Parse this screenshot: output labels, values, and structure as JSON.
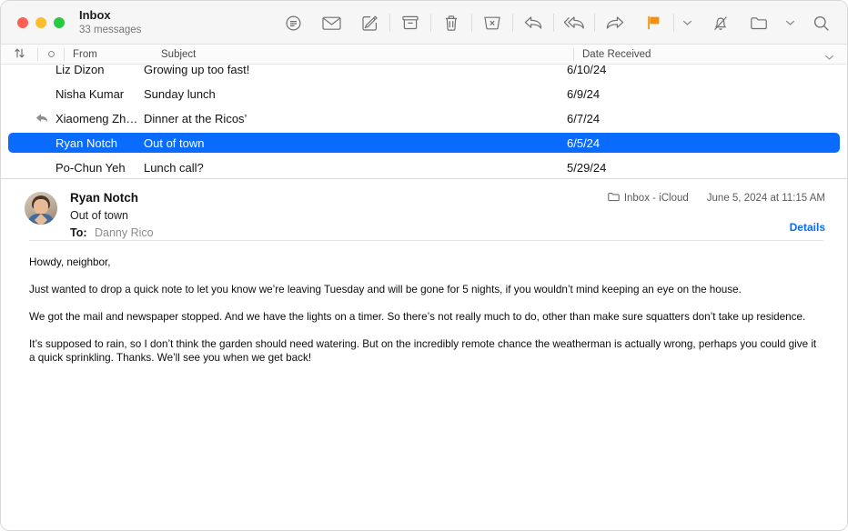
{
  "window": {
    "title": "Inbox",
    "subtitle": "33 messages",
    "traffic_lights": [
      "close-red",
      "minimize-yellow",
      "zoom-green"
    ]
  },
  "toolbar": {
    "items": [
      {
        "name": "filter-icon",
        "label": "Filter"
      },
      {
        "name": "mark-unread-envelope-icon",
        "label": "Mark as Unread"
      },
      {
        "name": "compose-icon",
        "label": "New Message"
      },
      {
        "name": "archive-icon",
        "label": "Archive"
      },
      {
        "name": "trash-icon",
        "label": "Delete"
      },
      {
        "name": "junk-icon",
        "label": "Move to Junk"
      },
      {
        "name": "reply-icon",
        "label": "Reply"
      },
      {
        "name": "reply-all-icon",
        "label": "Reply All"
      },
      {
        "name": "forward-icon",
        "label": "Forward"
      },
      {
        "name": "flag-icon",
        "label": "Flag"
      },
      {
        "name": "flag-chevron-down-icon",
        "label": "Flag options"
      },
      {
        "name": "mute-bell-icon",
        "label": "Mute"
      },
      {
        "name": "move-folder-icon",
        "label": "Move to"
      },
      {
        "name": "move-chevron-down-icon",
        "label": "Move options"
      },
      {
        "name": "search-icon",
        "label": "Search"
      }
    ],
    "flag_color": "#f59008",
    "icon_color": "#707070"
  },
  "list_header": {
    "sort_icon": "sort-arrows-icon",
    "unread_icon": "unread-circle-icon",
    "from": "From",
    "subject": "Subject",
    "date": "Date Received",
    "chevron_icon": "chevron-down-icon"
  },
  "messages": [
    {
      "from": "Liz Dizon",
      "subject": "Growing up too fast!",
      "date": "6/10/24",
      "replied": false,
      "selected": false
    },
    {
      "from": "Nisha Kumar",
      "subject": "Sunday lunch",
      "date": "6/9/24",
      "replied": false,
      "selected": false
    },
    {
      "from": "Xiaomeng Zh…",
      "subject": "Dinner at the Ricos’",
      "date": "6/7/24",
      "replied": true,
      "selected": false
    },
    {
      "from": "Ryan Notch",
      "subject": "Out of town",
      "date": "6/5/24",
      "replied": false,
      "selected": true
    },
    {
      "from": "Po-Chun Yeh",
      "subject": "Lunch call?",
      "date": "5/29/24",
      "replied": false,
      "selected": false
    }
  ],
  "selection_color": "#0a6cff",
  "message": {
    "sender": "Ryan Notch",
    "subject": "Out of town",
    "to_label": "To:",
    "to_value": "Danny Rico",
    "mailbox_icon": "folder-icon",
    "mailbox": "Inbox - iCloud",
    "timestamp": "June 5, 2024 at 11:15 AM",
    "details_link": "Details",
    "avatar": "avatar",
    "body": [
      "Howdy, neighbor,",
      "Just wanted to drop a quick note to let you know we’re leaving Tuesday and will be gone for 5 nights, if you wouldn’t mind keeping an eye on the house.",
      "We got the mail and newspaper stopped. And we have the lights on a timer. So there’s not really much to do, other than make sure squatters don’t take up residence.",
      "It’s supposed to rain, so I don’t think the garden should need watering. But on the incredibly remote chance the weatherman is actually wrong, perhaps you could give it a quick sprinkling. Thanks. We’ll see you when we get back!"
    ]
  }
}
